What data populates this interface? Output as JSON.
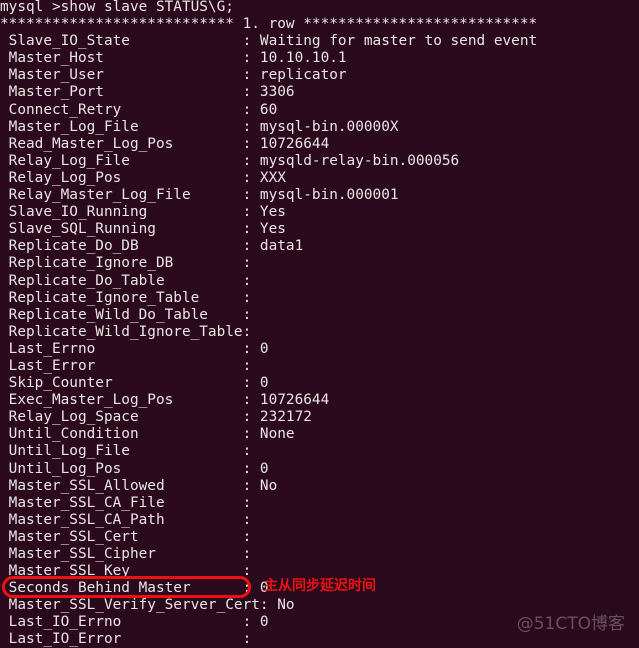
{
  "terminal": {
    "background_color": "#2c0a1e",
    "text_color": "#e8e6e3",
    "prompt_line": "mysql >show slave STATUS\\G;",
    "row_separator": "*************************** 1. row ***************************",
    "rows": [
      {
        "label": "Slave_IO_State",
        "value": "Waiting for master to send event"
      },
      {
        "label": "Master_Host",
        "value": "10.10.10.1"
      },
      {
        "label": "Master_User",
        "value": "replicator"
      },
      {
        "label": "Master_Port",
        "value": "3306"
      },
      {
        "label": "Connect_Retry",
        "value": "60"
      },
      {
        "label": "Master_Log_File",
        "value": "mysql-bin.00000X"
      },
      {
        "label": "Read_Master_Log_Pos",
        "value": "10726644"
      },
      {
        "label": "Relay_Log_File",
        "value": "mysqld-relay-bin.000056"
      },
      {
        "label": "Relay_Log_Pos",
        "value": "XXX"
      },
      {
        "label": "Relay_Master_Log_File",
        "value": "mysql-bin.000001"
      },
      {
        "label": "Slave_IO_Running",
        "value": "Yes"
      },
      {
        "label": "Slave_SQL_Running",
        "value": "Yes"
      },
      {
        "label": "Replicate_Do_DB",
        "value": "data1"
      },
      {
        "label": "Replicate_Ignore_DB",
        "value": ""
      },
      {
        "label": "Replicate_Do_Table",
        "value": ""
      },
      {
        "label": "Replicate_Ignore_Table",
        "value": ""
      },
      {
        "label": "Replicate_Wild_Do_Table",
        "value": ""
      },
      {
        "label": "Replicate_Wild_Ignore_Table",
        "value": ""
      },
      {
        "label": "Last_Errno",
        "value": "0"
      },
      {
        "label": "Last_Error",
        "value": ""
      },
      {
        "label": "Skip_Counter",
        "value": "0"
      },
      {
        "label": "Exec_Master_Log_Pos",
        "value": "10726644"
      },
      {
        "label": "Relay_Log_Space",
        "value": "232172"
      },
      {
        "label": "Until_Condition",
        "value": "None"
      },
      {
        "label": "Until_Log_File",
        "value": ""
      },
      {
        "label": "Until_Log_Pos",
        "value": "0"
      },
      {
        "label": "Master_SSL_Allowed",
        "value": "No"
      },
      {
        "label": "Master_SSL_CA_File",
        "value": ""
      },
      {
        "label": "Master_SSL_CA_Path",
        "value": ""
      },
      {
        "label": "Master_SSL_Cert",
        "value": ""
      },
      {
        "label": "Master_SSL_Cipher",
        "value": ""
      },
      {
        "label": "Master_SSL_Key",
        "value": ""
      },
      {
        "label": "Seconds_Behind_Master",
        "value": "0"
      },
      {
        "label": "Master_SSL_Verify_Server_Cert",
        "value": "No"
      },
      {
        "label": "Last_IO_Errno",
        "value": "0"
      },
      {
        "label": "Last_IO_Error",
        "value": ""
      }
    ],
    "label_column_width": 27
  },
  "annotation": {
    "text": "主从同步延迟时间",
    "color": "#ee1111",
    "target_label": "Seconds_Behind_Master"
  },
  "watermark": {
    "text": "@51CTO博客",
    "color": "#6b5560"
  }
}
